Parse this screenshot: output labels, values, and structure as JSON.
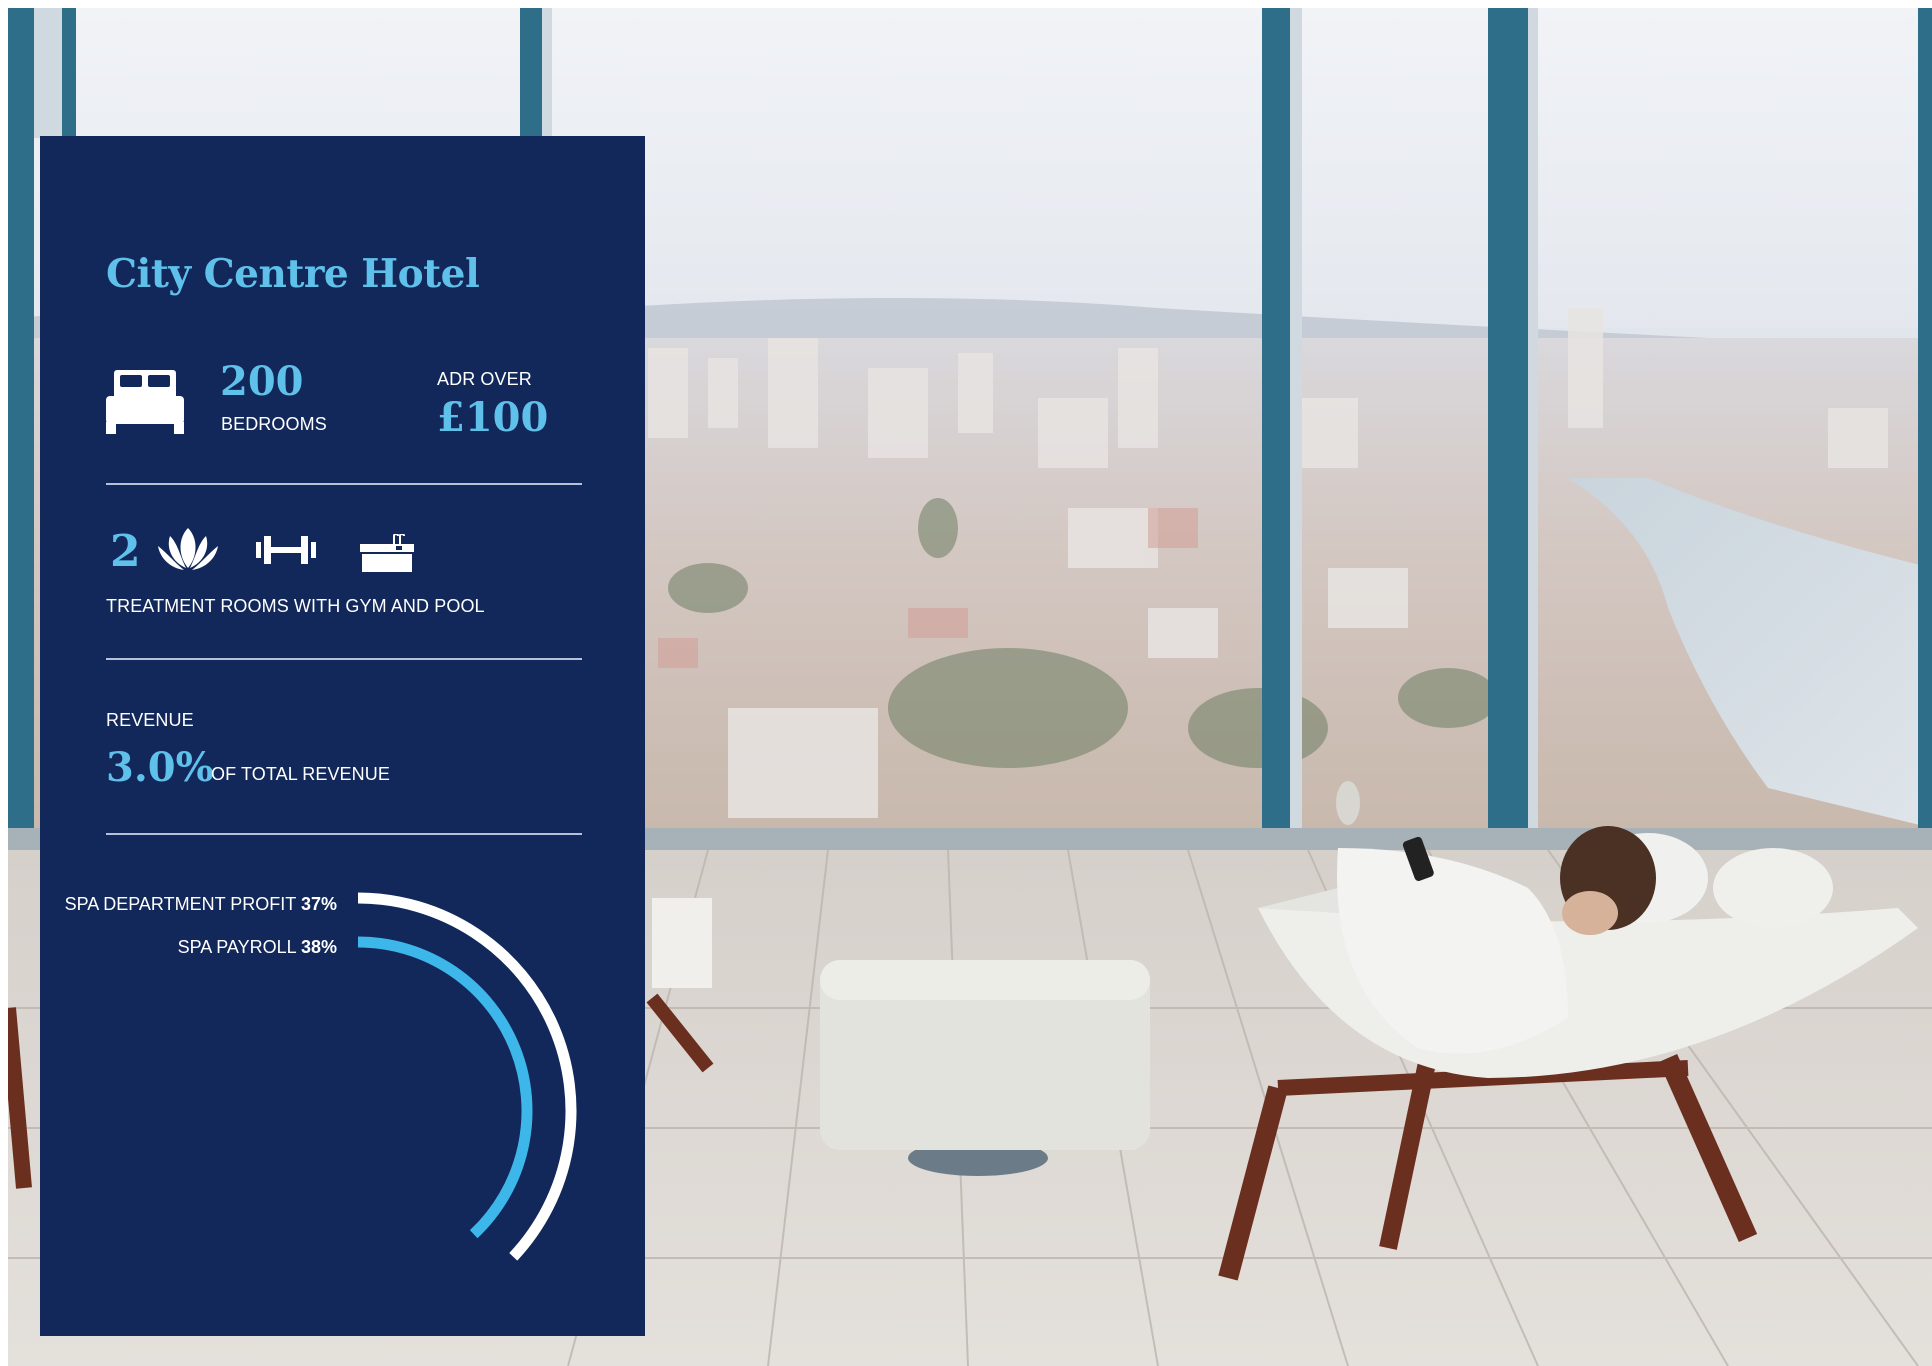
{
  "card": {
    "title": "City Centre Hotel",
    "bedrooms": {
      "value": "200",
      "label": "BEDROOMS",
      "icon": "bed-icon"
    },
    "adr": {
      "label": "ADR OVER",
      "value": "£100"
    },
    "treatment": {
      "count": "2",
      "label": "TREATMENT ROOMS WITH GYM AND POOL",
      "icons": [
        "lotus-icon",
        "dumbbell-icon",
        "pool-icon"
      ]
    },
    "revenue": {
      "heading": "REVENUE",
      "value": "3.0%",
      "suffix": "OF TOTAL REVENUE"
    },
    "arcs": [
      {
        "name": "SPA DEPARTMENT PROFIT",
        "value_label": "37%",
        "fraction": 0.37,
        "color": "#ffffff"
      },
      {
        "name": "SPA PAYROLL",
        "value_label": "38%",
        "fraction": 0.38,
        "color": "#3db6ea"
      }
    ]
  },
  "colors": {
    "card_bg": "#12275a",
    "accent": "#5fc0ea",
    "arc_blue": "#3db6ea",
    "text": "#ffffff"
  }
}
